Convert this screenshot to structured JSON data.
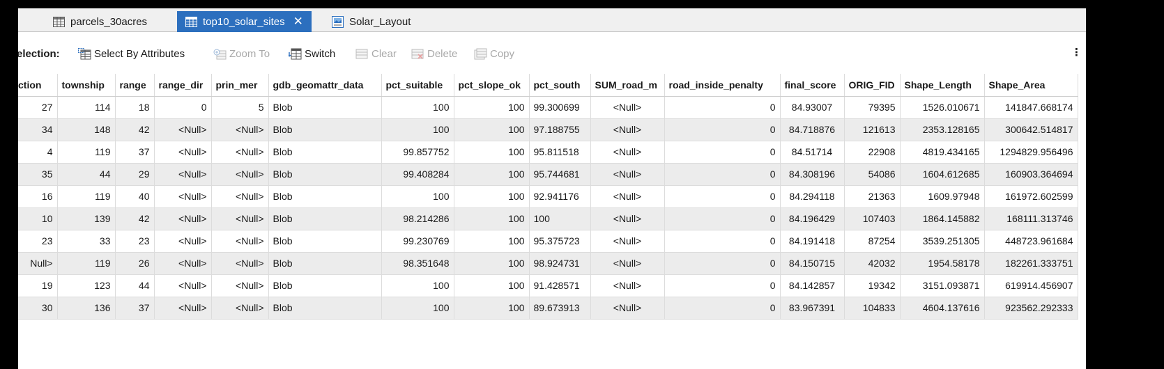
{
  "tabs": [
    {
      "label": "parcels_30acres",
      "icon": "table-icon",
      "active": false
    },
    {
      "label": "top10_solar_sites",
      "icon": "table-icon",
      "active": true,
      "close": "✕"
    },
    {
      "label": "Solar_Layout",
      "icon": "layout-icon",
      "active": false
    }
  ],
  "toolbar": {
    "selection_label": "election:",
    "select_by_attributes": "Select By Attributes",
    "zoom_to": "Zoom To",
    "switch": "Switch",
    "clear": "Clear",
    "delete": "Delete",
    "copy": "Copy"
  },
  "table": {
    "columns": [
      "ction",
      "township",
      "range",
      "range_dir",
      "prin_mer",
      "gdb_geomattr_data",
      "pct_suitable",
      "pct_slope_ok",
      "pct_south",
      "SUM_road_m",
      "road_inside_penalty",
      "final_score",
      "ORIG_FID",
      "Shape_Length",
      "Shape_Area"
    ],
    "rows": [
      [
        "27",
        "114",
        "18",
        "0",
        "5",
        "Blob",
        "100",
        "100",
        "99.300699",
        "<Null>",
        "0",
        "84.93007",
        "79395",
        "1526.010671",
        "141847.668174"
      ],
      [
        "34",
        "148",
        "42",
        "<Null>",
        "<Null>",
        "Blob",
        "100",
        "100",
        "97.188755",
        "<Null>",
        "0",
        "84.718876",
        "121613",
        "2353.128165",
        "300642.514817"
      ],
      [
        "4",
        "119",
        "37",
        "<Null>",
        "<Null>",
        "Blob",
        "99.857752",
        "100",
        "95.811518",
        "<Null>",
        "0",
        "84.51714",
        "22908",
        "4819.434165",
        "1294829.956496"
      ],
      [
        "35",
        "44",
        "29",
        "<Null>",
        "<Null>",
        "Blob",
        "99.408284",
        "100",
        "95.744681",
        "<Null>",
        "0",
        "84.308196",
        "54086",
        "1604.612685",
        "160903.364694"
      ],
      [
        "16",
        "119",
        "40",
        "<Null>",
        "<Null>",
        "Blob",
        "100",
        "100",
        "92.941176",
        "<Null>",
        "0",
        "84.294118",
        "21363",
        "1609.97948",
        "161972.602599"
      ],
      [
        "10",
        "139",
        "42",
        "<Null>",
        "<Null>",
        "Blob",
        "98.214286",
        "100",
        "100",
        "<Null>",
        "0",
        "84.196429",
        "107403",
        "1864.145882",
        "168111.313746"
      ],
      [
        "23",
        "33",
        "23",
        "<Null>",
        "<Null>",
        "Blob",
        "99.230769",
        "100",
        "95.375723",
        "<Null>",
        "0",
        "84.191418",
        "87254",
        "3539.251305",
        "448723.961684"
      ],
      [
        "Null>",
        "119",
        "26",
        "<Null>",
        "<Null>",
        "Blob",
        "98.351648",
        "100",
        "98.924731",
        "<Null>",
        "0",
        "84.150715",
        "42032",
        "1954.58178",
        "182261.333751"
      ],
      [
        "19",
        "123",
        "44",
        "<Null>",
        "<Null>",
        "Blob",
        "100",
        "100",
        "91.428571",
        "<Null>",
        "0",
        "84.142857",
        "19342",
        "3151.093871",
        "619914.456907"
      ],
      [
        "30",
        "136",
        "37",
        "<Null>",
        "<Null>",
        "Blob",
        "100",
        "100",
        "89.673913",
        "<Null>",
        "0",
        "83.967391",
        "104833",
        "4604.137616",
        "923562.292333"
      ]
    ]
  },
  "colors": {
    "active_tab": "#2c6fbe",
    "alt_row": "#ececec",
    "disabled_text": "#a9a9a9"
  }
}
